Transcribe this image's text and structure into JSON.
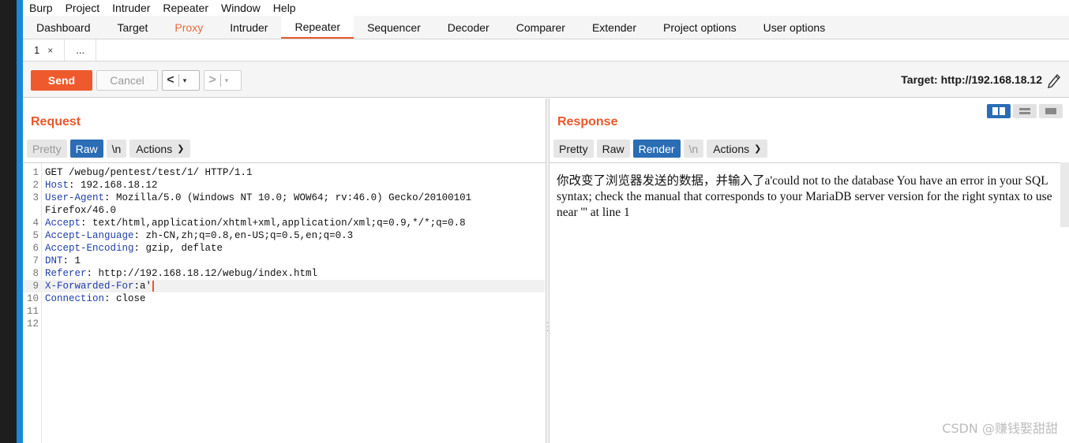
{
  "menu": [
    "Burp",
    "Project",
    "Intruder",
    "Repeater",
    "Window",
    "Help"
  ],
  "tabs": [
    {
      "label": "Dashboard"
    },
    {
      "label": "Target"
    },
    {
      "label": "Proxy"
    },
    {
      "label": "Intruder"
    },
    {
      "label": "Repeater"
    },
    {
      "label": "Sequencer"
    },
    {
      "label": "Decoder"
    },
    {
      "label": "Comparer"
    },
    {
      "label": "Extender"
    },
    {
      "label": "Project options"
    },
    {
      "label": "User options"
    }
  ],
  "active_tab": "Repeater",
  "subtabs": {
    "first": "1",
    "close": "×",
    "more": "..."
  },
  "toolbar": {
    "send": "Send",
    "cancel": "Cancel",
    "back": "<",
    "forward": ">",
    "dropdown": "▾",
    "target": "Target: http://192.168.18.12"
  },
  "request": {
    "title": "Request",
    "modes": {
      "pretty": "Pretty",
      "raw": "Raw",
      "newline": "\\n",
      "actions": "Actions"
    },
    "lines": [
      {
        "n": "1",
        "name": "",
        "rest": "GET /webug/pentest/test/1/ HTTP/1.1"
      },
      {
        "n": "2",
        "name": "Host",
        "rest": ": 192.168.18.12"
      },
      {
        "n": "3",
        "name": "User-Agent",
        "rest": ": Mozilla/5.0 (Windows NT 10.0; WOW64; rv:46.0) Gecko/20100101"
      },
      {
        "n": "",
        "name": "",
        "rest": "Firefox/46.0"
      },
      {
        "n": "4",
        "name": "Accept",
        "rest": ": text/html,application/xhtml+xml,application/xml;q=0.9,*/*;q=0.8"
      },
      {
        "n": "5",
        "name": "Accept-Language",
        "rest": ": zh-CN,zh;q=0.8,en-US;q=0.5,en;q=0.3"
      },
      {
        "n": "6",
        "name": "Accept-Encoding",
        "rest": ": gzip, deflate"
      },
      {
        "n": "7",
        "name": "DNT",
        "rest": ": 1"
      },
      {
        "n": "8",
        "name": "Referer",
        "rest": ": http://192.168.18.12/webug/index.html"
      },
      {
        "n": "9",
        "name": "X-Forwarded-For",
        "rest": ":a'"
      },
      {
        "n": "10",
        "name": "Connection",
        "rest": ": close"
      },
      {
        "n": "11",
        "name": "",
        "rest": ""
      },
      {
        "n": "12",
        "name": "",
        "rest": ""
      }
    ]
  },
  "response": {
    "title": "Response",
    "modes": {
      "pretty": "Pretty",
      "raw": "Raw",
      "render": "Render",
      "newline": "\\n",
      "actions": "Actions"
    },
    "render_text": "你改变了浏览器发送的数据，并输入了a'could not to the database You have an error in your SQL syntax; check the manual that corresponds to your MariaDB server version for the right syntax to use near ''' at line 1"
  },
  "watermark": "CSDN @赚钱娶甜甜",
  "colors": {
    "accent": "#e8582a",
    "selected": "#2a6db5",
    "header_name": "#1f3fa8"
  }
}
